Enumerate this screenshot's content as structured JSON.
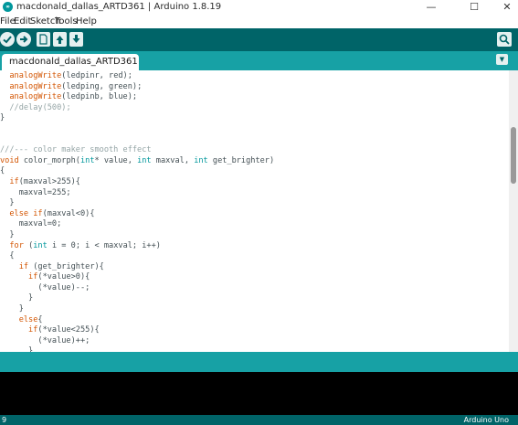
{
  "window": {
    "title": "macdonald_dallas_ARTD361 | Arduino 1.8.19",
    "icon": "arduino-logo",
    "controls": {
      "minimize": "—",
      "maximize": "☐",
      "close": "✕"
    }
  },
  "menu": {
    "items": [
      "File",
      "Edit",
      "Sketch",
      "Tools",
      "Help"
    ]
  },
  "toolbar": {
    "buttons": [
      "verify-icon",
      "upload-icon",
      "new-icon",
      "open-icon",
      "save-icon",
      "serial-monitor-icon"
    ],
    "accent": "#006468"
  },
  "tabs": {
    "active": "macdonald_dallas_ARTD361",
    "menu_glyph": "▼"
  },
  "code": [
    "  analogWrite(ledpinr, red);",
    "  analogWrite(ledping, green);",
    "  analogWrite(ledpinb, blue);",
    "  //delay(500);",
    "}",
    "",
    "",
    "///--- color maker smooth effect",
    "void color_morph(int* value, int maxval, int get_brighter)",
    "{",
    "  if(maxval>255){",
    "    maxval=255;",
    "  }",
    "  else if(maxval<0){",
    "    maxval=0;",
    "  }",
    "  for (int i = 0; i < maxval; i++)",
    "  {",
    "    if (get_brighter){",
    "      if(*value>0){",
    "        (*value)--;",
    "      }",
    "    }",
    "    else{",
    "      if(*value<255){",
    "        (*value)++;",
    "      }"
  ],
  "footer": {
    "line_number": "9",
    "board": "Arduino Uno"
  },
  "colors": {
    "toolbar": "#006468",
    "tabbar": "#17a1a5",
    "console": "#000000",
    "keyword": "#d35400",
    "type": "#00979c",
    "comment": "#95a5a6"
  }
}
